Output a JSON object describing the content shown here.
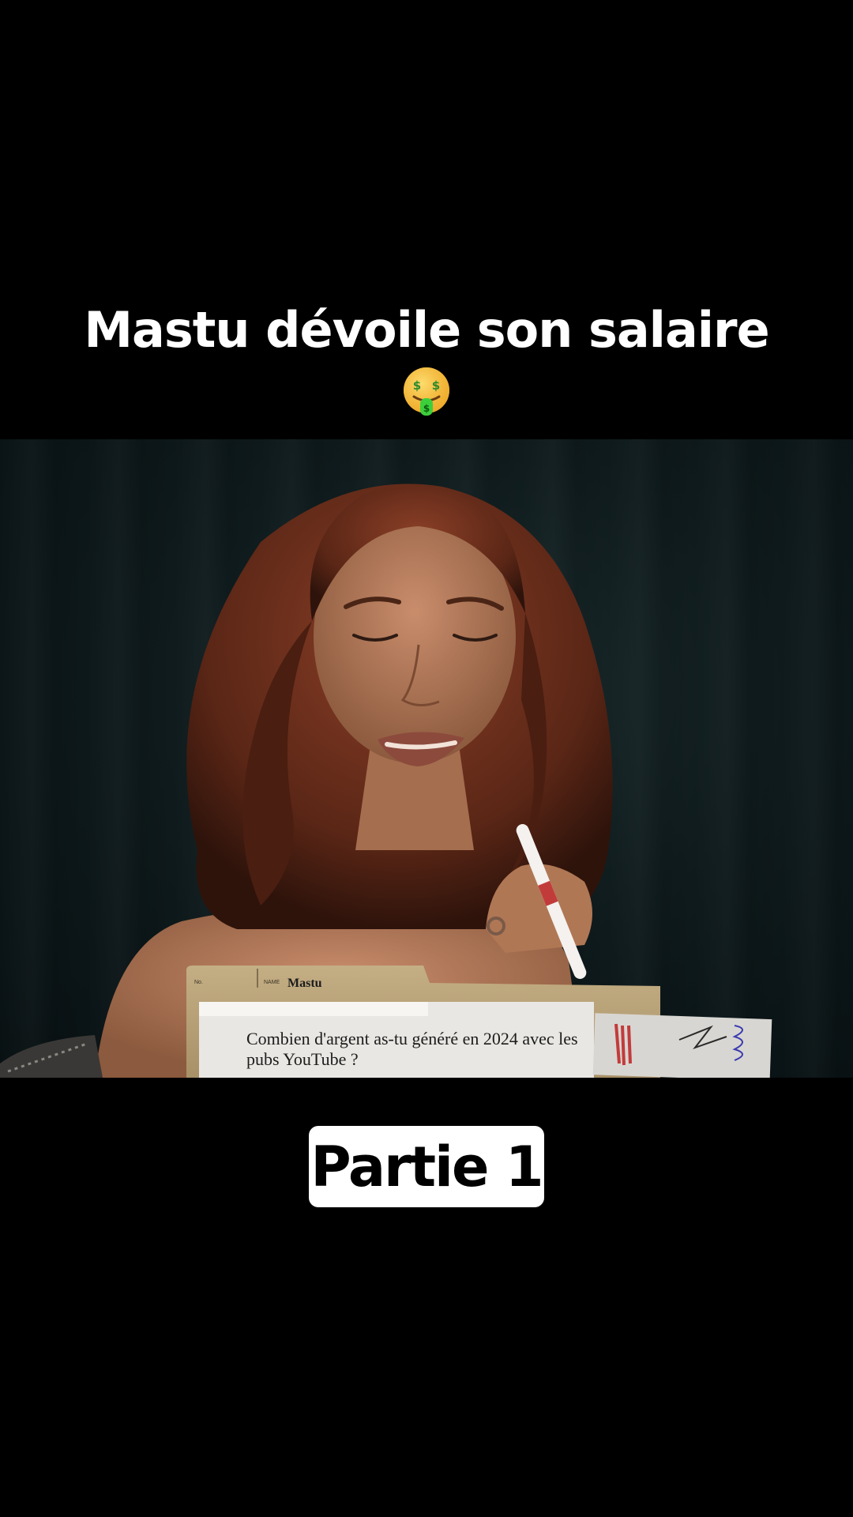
{
  "caption": {
    "title": "Mastu dévoile son salaire",
    "emoji": "money-mouth-face"
  },
  "video": {
    "folder": {
      "no_label": "No.",
      "name_label": "NAME",
      "name": "Mastu",
      "question": "Combien d'argent as-tu généré en 2024 avec les pubs YouTube ?"
    }
  },
  "part_label": "Partie 1",
  "colors": {
    "background": "#000000",
    "caption_text": "#ffffff",
    "badge_bg": "#ffffff",
    "badge_text": "#000000"
  }
}
